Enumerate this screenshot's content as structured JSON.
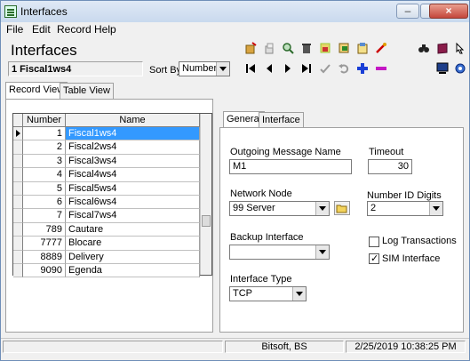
{
  "window": {
    "title": "Interfaces"
  },
  "menu": {
    "items": [
      "File",
      "Edit",
      "Record",
      "Help"
    ]
  },
  "header": {
    "title": "Interfaces",
    "current_record": "1 Fiscal1ws4",
    "sort_by_label": "Sort By",
    "sort_by_value": "Number"
  },
  "toolbar": {
    "icons": [
      "new-record-icon",
      "copy-record-icon",
      "find-record-icon",
      "delete-record-icon",
      "print-icon",
      "preview-icon",
      "filter-icon",
      "export-icon",
      "binoculars-icon",
      "book-icon",
      "help-icon",
      "first-record-icon",
      "previous-record-icon",
      "next-record-icon",
      "last-record-icon",
      "save-icon",
      "undo-icon",
      "add-icon",
      "remove-icon",
      "screen-icon",
      "settings-icon"
    ]
  },
  "view_tabs": [
    "Record View",
    "Table View"
  ],
  "grid": {
    "columns": [
      "Number",
      "Name"
    ],
    "rows": [
      {
        "number": "1",
        "name": "Fiscal1ws4",
        "selected": true
      },
      {
        "number": "2",
        "name": "Fiscal2ws4"
      },
      {
        "number": "3",
        "name": "Fiscal3ws4"
      },
      {
        "number": "4",
        "name": "Fiscal4ws4"
      },
      {
        "number": "5",
        "name": "Fiscal5ws4"
      },
      {
        "number": "6",
        "name": "Fiscal6ws4"
      },
      {
        "number": "7",
        "name": "Fiscal7ws4"
      },
      {
        "number": "789",
        "name": "Cautare"
      },
      {
        "number": "7777",
        "name": "Blocare"
      },
      {
        "number": "8889",
        "name": "Delivery"
      },
      {
        "number": "9090",
        "name": "Egenda"
      }
    ]
  },
  "detail_tabs": [
    "General",
    "Interface"
  ],
  "form": {
    "outgoing_message_name": {
      "label": "Outgoing Message Name",
      "value": "M1"
    },
    "timeout": {
      "label": "Timeout",
      "value": "30"
    },
    "network_node": {
      "label": "Network Node",
      "value": "99  Server"
    },
    "number_id_digits": {
      "label": "Number ID Digits",
      "value": "2"
    },
    "backup_interface": {
      "label": "Backup Interface",
      "value": ""
    },
    "log_transactions": {
      "label": "Log Transactions",
      "checked": false
    },
    "sim_interface": {
      "label": "SIM Interface",
      "checked": true
    },
    "interface_type": {
      "label": "Interface Type",
      "value": "TCP"
    }
  },
  "status": {
    "user": "Bitsoft, BS",
    "datetime": "2/25/2019 10:38:25 PM"
  }
}
